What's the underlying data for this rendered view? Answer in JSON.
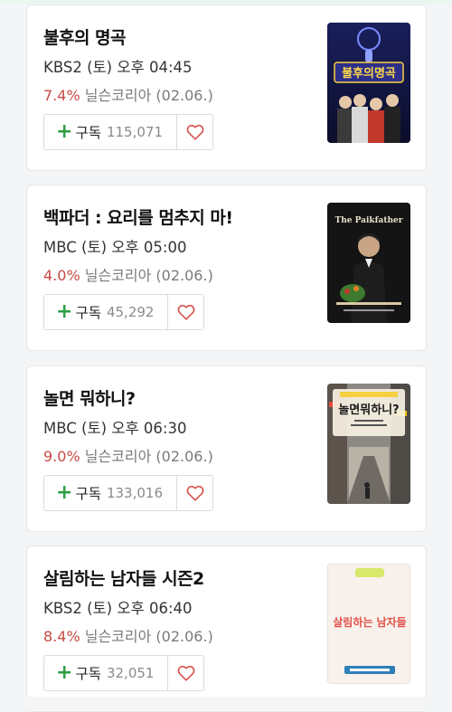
{
  "programs": [
    {
      "title": "불후의 명곡",
      "schedule": "KBS2 (토) 오후 04:45",
      "rating": "7.4%",
      "rating_source": "닐슨코리아 (02.06.)",
      "subscribe_label": "구독",
      "subscribers": "115,071",
      "poster_text": "불후의명곡"
    },
    {
      "title": "백파더 : 요리를 멈추지 마!",
      "schedule": "MBC (토) 오후 05:00",
      "rating": "4.0%",
      "rating_source": "닐슨코리아 (02.06.)",
      "subscribe_label": "구독",
      "subscribers": "45,292",
      "poster_text": "The Paikfather"
    },
    {
      "title": "놀면 뭐하니?",
      "schedule": "MBC (토) 오후 06:30",
      "rating": "9.0%",
      "rating_source": "닐슨코리아 (02.06.)",
      "subscribe_label": "구독",
      "subscribers": "133,016",
      "poster_text": "놀면뭐하니?"
    },
    {
      "title": "살림하는 남자들 시즌2",
      "schedule": "KBS2 (토) 오후 06:40",
      "rating": "8.4%",
      "rating_source": "닐슨코리아 (02.06.)",
      "subscribe_label": "구독",
      "subscribers": "32,051",
      "poster_text": "살림하는 남자들"
    }
  ],
  "icons": {
    "subscribe": "plus-icon",
    "favorite": "heart-outline-icon"
  },
  "colors": {
    "rating": "#c94a44",
    "plus": "#2f9e44",
    "heart": "#d9534f"
  }
}
